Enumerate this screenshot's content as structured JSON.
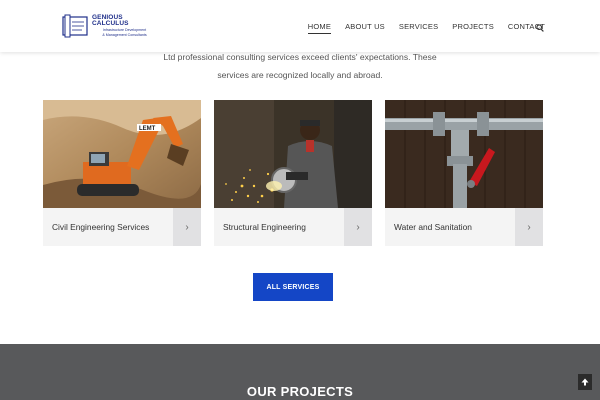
{
  "header": {
    "logo": {
      "name": "GENIOUS CALCULUS",
      "subtitle_line1": "Infrastructure Development",
      "subtitle_line2": "& Management Consultants"
    },
    "nav": [
      {
        "label": "HOME",
        "active": true
      },
      {
        "label": "ABOUT US",
        "active": false
      },
      {
        "label": "SERVICES",
        "active": false
      },
      {
        "label": "PROJECTS",
        "active": false
      },
      {
        "label": "CONTACT",
        "active": false
      }
    ],
    "search_icon": "search-icon"
  },
  "intro": {
    "line1": "Ltd professional consulting services exceed clients' expectations. These",
    "line2": "services are recognized locally and abroad."
  },
  "services": [
    {
      "label": "Civil Engineering Services",
      "image": "excavator-photo",
      "arrow": "›"
    },
    {
      "label": "Structural Engineering",
      "image": "grinding-worker-photo",
      "arrow": "›"
    },
    {
      "label": "Water and Sanitation",
      "image": "water-pipe-valve-photo",
      "arrow": "›"
    }
  ],
  "all_services_button": "ALL SERVICES",
  "projects": {
    "title": "OUR PROJECTS"
  },
  "scroll_top_icon": "arrow-up-icon",
  "colors": {
    "brand_blue": "#1f2f8a",
    "button_blue": "#1446c6",
    "projects_bg": "#58595b",
    "card_bg": "#f4f4f4"
  }
}
